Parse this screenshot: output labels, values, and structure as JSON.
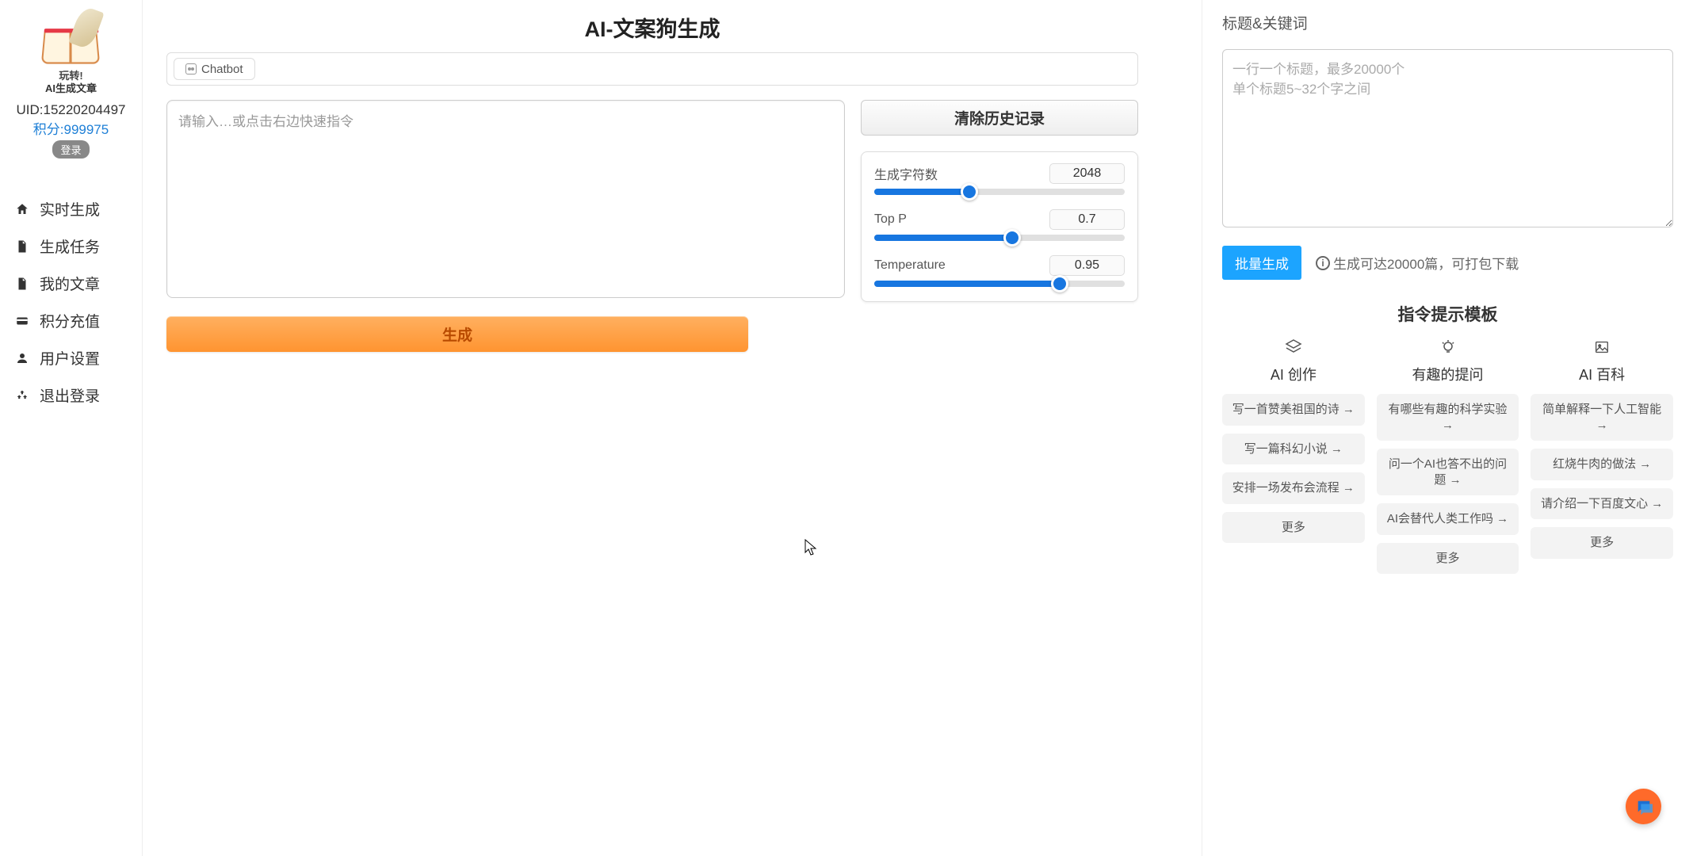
{
  "sidebar": {
    "logo_line1": "玩转!",
    "logo_line2": "AI生成文章",
    "uid_label": "UID:15220204497",
    "points_label": "积分:999975",
    "login_label": "登录",
    "nav": [
      {
        "label": "实时生成",
        "icon": "home"
      },
      {
        "label": "生成任务",
        "icon": "file"
      },
      {
        "label": "我的文章",
        "icon": "file"
      },
      {
        "label": "积分充值",
        "icon": "card"
      },
      {
        "label": "用户设置",
        "icon": "user"
      },
      {
        "label": "退出登录",
        "icon": "recycle"
      }
    ]
  },
  "main": {
    "title": "AI-文案狗生成",
    "chatbot_tab": "Chatbot",
    "prompt_placeholder": "请输入…或点击右边快速指令",
    "clear_history": "清除历史记录",
    "sliders": {
      "char_count": {
        "label": "生成字符数",
        "value": "2048",
        "fill_pct": 38
      },
      "top_p": {
        "label": "Top P",
        "value": "0.7",
        "fill_pct": 55
      },
      "temperature": {
        "label": "Temperature",
        "value": "0.95",
        "fill_pct": 74
      }
    },
    "generate": "生成"
  },
  "right": {
    "label": "标题&关键词",
    "textarea_placeholder": "一行一个标题，最多20000个\n单个标题5~32个字之间",
    "batch_btn": "批量生成",
    "batch_note": "生成可达20000篇，可打包下载",
    "templates_title": "指令提示模板",
    "columns": [
      {
        "title": "AI 创作",
        "items": [
          "写一首赞美祖国的诗 →",
          "写一篇科幻小说 →",
          "安排一场发布会流程 →",
          "更多"
        ]
      },
      {
        "title": "有趣的提问",
        "items": [
          "有哪些有趣的科学实验 →",
          "问一个AI也答不出的问题 →",
          "AI会替代人类工作吗 →",
          "更多"
        ]
      },
      {
        "title": "AI 百科",
        "items": [
          "简单解释一下人工智能 →",
          "红烧牛肉的做法 →",
          "请介绍一下百度文心 →",
          "更多"
        ]
      }
    ]
  }
}
